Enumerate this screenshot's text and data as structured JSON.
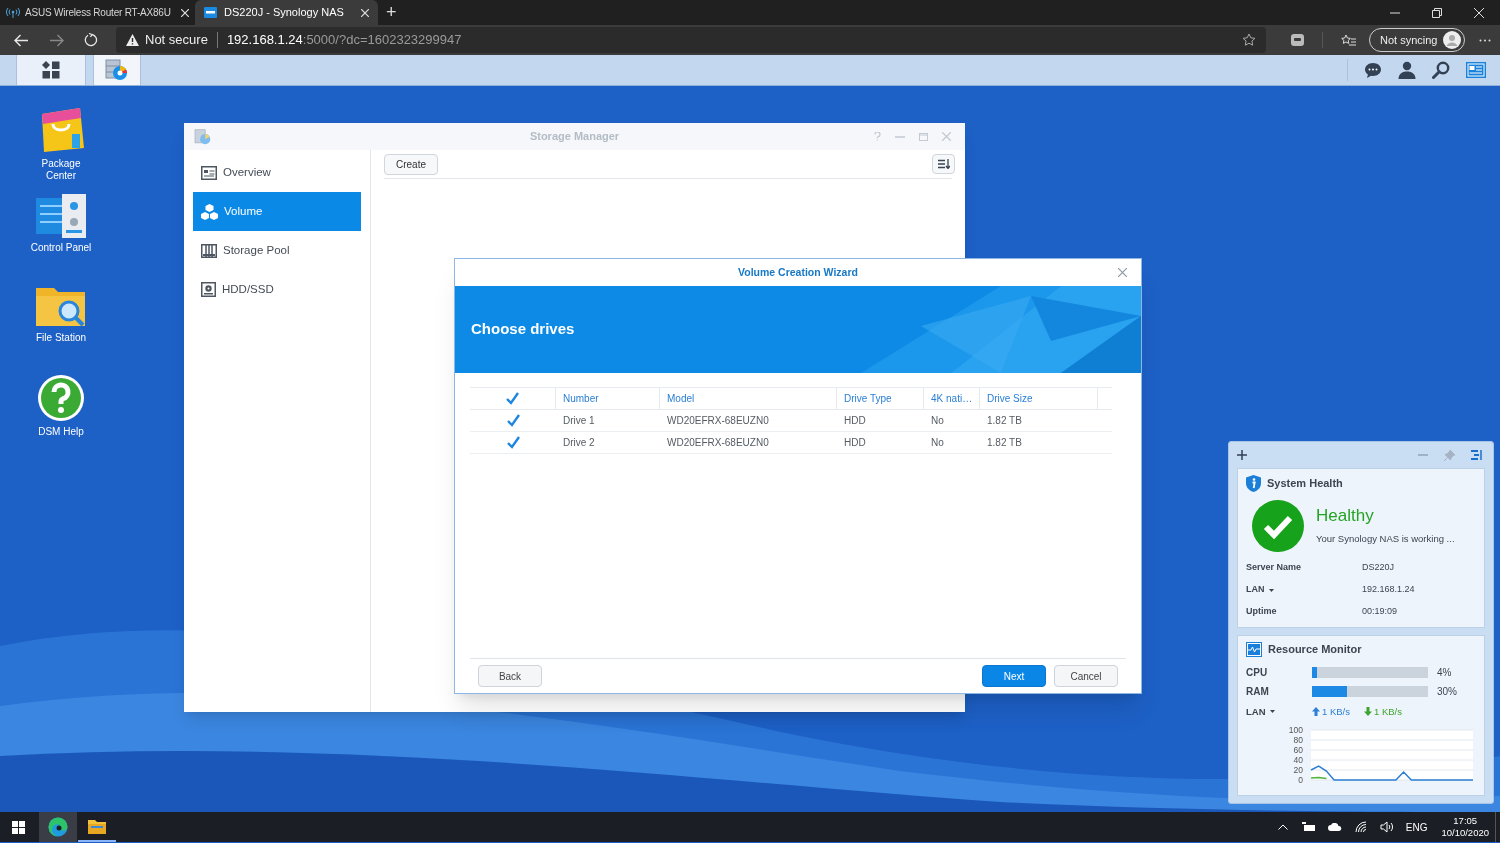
{
  "browser": {
    "tabs": [
      {
        "title": "ASUS Wireless Router RT-AX86U",
        "selected": false
      },
      {
        "title": "DS220J - Synology NAS",
        "selected": true
      }
    ],
    "new_tab": "+",
    "address": {
      "security": "Not secure",
      "host": "192.168.1.24",
      "path": ":5000/?dc=1602323299947"
    },
    "sync": "Not syncing"
  },
  "desktop_icons": [
    {
      "label": "Package Center"
    },
    {
      "label": "Control Panel"
    },
    {
      "label": "File Station"
    },
    {
      "label": "DSM Help"
    }
  ],
  "storage_manager": {
    "title": "Storage Manager",
    "sidebar": [
      {
        "label": "Overview",
        "selected": false
      },
      {
        "label": "Volume",
        "selected": true
      },
      {
        "label": "Storage Pool",
        "selected": false
      },
      {
        "label": "HDD/SSD",
        "selected": false
      }
    ],
    "create_button": "Create"
  },
  "wizard": {
    "title": "Volume Creation Wizard",
    "heading": "Choose drives",
    "table": {
      "all_checked": true,
      "columns": [
        "Number",
        "Model",
        "Drive Type",
        "4K nati…",
        "Drive Size"
      ],
      "rows": [
        {
          "checked": true,
          "cells": [
            "Drive 1",
            "WD20EFRX-68EUZN0",
            "HDD",
            "No",
            "1.82 TB"
          ]
        },
        {
          "checked": true,
          "cells": [
            "Drive 2",
            "WD20EFRX-68EUZN0",
            "HDD",
            "No",
            "1.82 TB"
          ]
        }
      ]
    },
    "buttons": [
      {
        "label": "Back",
        "kind": "secondary"
      },
      {
        "label": "Next",
        "kind": "primary"
      },
      {
        "label": "Cancel",
        "kind": "secondary"
      }
    ]
  },
  "system_health": {
    "title": "System Health",
    "status": "Healthy",
    "message": "Your Synology NAS is working ...",
    "rows": [
      {
        "label": "Server Name",
        "value": "DS220J",
        "kind": "text"
      },
      {
        "label": "LAN",
        "value": "192.168.1.24",
        "kind": "dropdown"
      },
      {
        "label": "Uptime",
        "value": "00:19:09",
        "kind": "text"
      }
    ]
  },
  "resource_monitor": {
    "title": "Resource Monitor",
    "meters": [
      {
        "label": "CPU",
        "level": 0.04,
        "reading": "4%"
      },
      {
        "label": "RAM",
        "level": 0.3,
        "reading": "30%"
      }
    ],
    "lan": {
      "label": "LAN",
      "upload": "1 KB/s",
      "download": "1 KB/s"
    },
    "chart_data": {
      "type": "line",
      "ylim": [
        0,
        100
      ],
      "yticks": [
        0,
        20,
        40,
        60,
        80,
        100
      ],
      "grid": true,
      "series": [
        {
          "color": "#2b7fd4",
          "values": [
            20,
            28,
            18,
            0,
            0,
            0,
            0,
            0,
            0,
            0,
            0,
            0,
            16,
            0,
            0,
            0,
            0,
            0,
            0,
            0,
            0,
            0
          ]
        },
        {
          "color": "#4fb33a",
          "values": [
            4,
            5,
            3,
            null,
            null,
            null,
            null,
            null,
            null,
            null,
            null,
            null,
            null,
            null,
            null,
            null,
            null,
            null,
            null,
            null,
            null,
            null
          ]
        }
      ]
    }
  },
  "taskbar": {
    "language": "ENG",
    "time": "17:05",
    "date": "10/10/2020"
  }
}
